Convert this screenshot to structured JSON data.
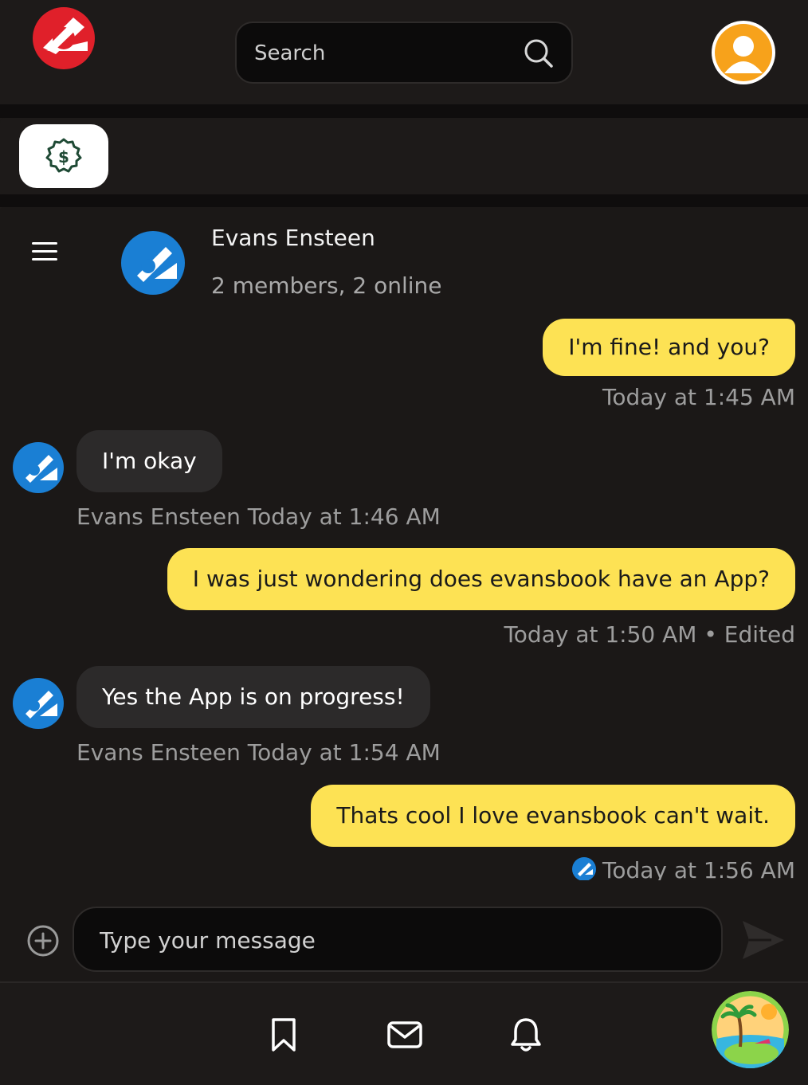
{
  "header": {
    "logo_icon": "evansbook-logo-red",
    "search": {
      "placeholder": "Search",
      "icon": "search-icon"
    },
    "profile_icon": "user-avatar-icon"
  },
  "actions": {
    "money_icon": "dollar-badge-icon"
  },
  "chat": {
    "title": "Evans Ensteen",
    "subtitle": "2 members, 2 online",
    "messages": [
      {
        "direction": "out",
        "text": "I'm fine! and you?",
        "meta": "Today at 1:45 AM"
      },
      {
        "direction": "in",
        "text": "I'm okay",
        "meta": "Evans Ensteen Today at 1:46 AM"
      },
      {
        "direction": "out",
        "text": "I was just wondering does evansbook have an App?",
        "meta": "Today at 1:50 AM • Edited"
      },
      {
        "direction": "in",
        "text": "Yes the App is on progress!",
        "meta": "Evans Ensteen Today at 1:54 AM"
      },
      {
        "direction": "out",
        "text": "Thats cool I love evansbook can't wait.",
        "meta": "Today at 1:56 AM"
      }
    ],
    "composer": {
      "placeholder": "Type your message"
    }
  },
  "bottom_nav": {
    "items": [
      "bookmark-icon",
      "mail-icon",
      "bell-icon"
    ],
    "profile": "beach-avatar"
  },
  "colors": {
    "background": "#1d1a19",
    "outgoing_bubble": "#fde254",
    "incoming_bubble": "#2c2a2a",
    "logo_red": "#e0202a",
    "logo_blue": "#1a7fd4"
  }
}
